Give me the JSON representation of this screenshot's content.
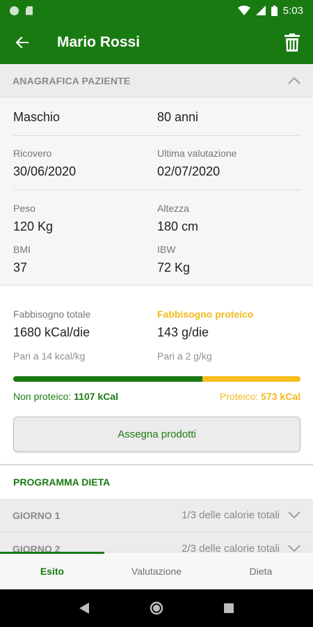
{
  "status_bar": {
    "time": "5:03"
  },
  "app_bar": {
    "title": "Mario Rossi"
  },
  "patient_section": {
    "header": "ANAGRAFICA PAZIENTE",
    "sex": "Maschio",
    "age": "80 anni",
    "admission_label": "Ricovero",
    "admission_value": "30/06/2020",
    "last_eval_label": "Ultima valutazione",
    "last_eval_value": "02/07/2020",
    "weight_label": "Peso",
    "weight_value": "120 Kg",
    "height_label": "Altezza",
    "height_value": "180 cm",
    "bmi_label": "BMI",
    "bmi_value": "37",
    "ibw_label": "IBW",
    "ibw_value": "72 Kg"
  },
  "needs": {
    "total_label": "Fabbisogno totale",
    "total_value": "1680 kCal/die",
    "total_sub": "Pari a 14 kcal/kg",
    "protein_label": "Fabbisogno proteico",
    "protein_value": "143 g/die",
    "protein_sub": "Pari a 2 g/kg",
    "non_protein_label": "Non proteico: ",
    "non_protein_value": "1107 kCal",
    "protein_kcal_label": "Proteico: ",
    "protein_kcal_value": "573 kCal",
    "non_protein_fraction": 0.659,
    "assign_button": "Assegna prodotti"
  },
  "program": {
    "title": "PROGRAMMA DIETA",
    "days": [
      {
        "name": "GIORNO 1",
        "info": "1/3 delle calorie totali"
      },
      {
        "name": "GIORNO 2",
        "info": "2/3 delle calorie totali"
      }
    ]
  },
  "tabs": [
    {
      "label": "Esito",
      "active": true
    },
    {
      "label": "Valutazione",
      "active": false
    },
    {
      "label": "Dieta",
      "active": false
    }
  ],
  "colors": {
    "primary": "#1a7a12",
    "accent": "#f5bd1d"
  }
}
